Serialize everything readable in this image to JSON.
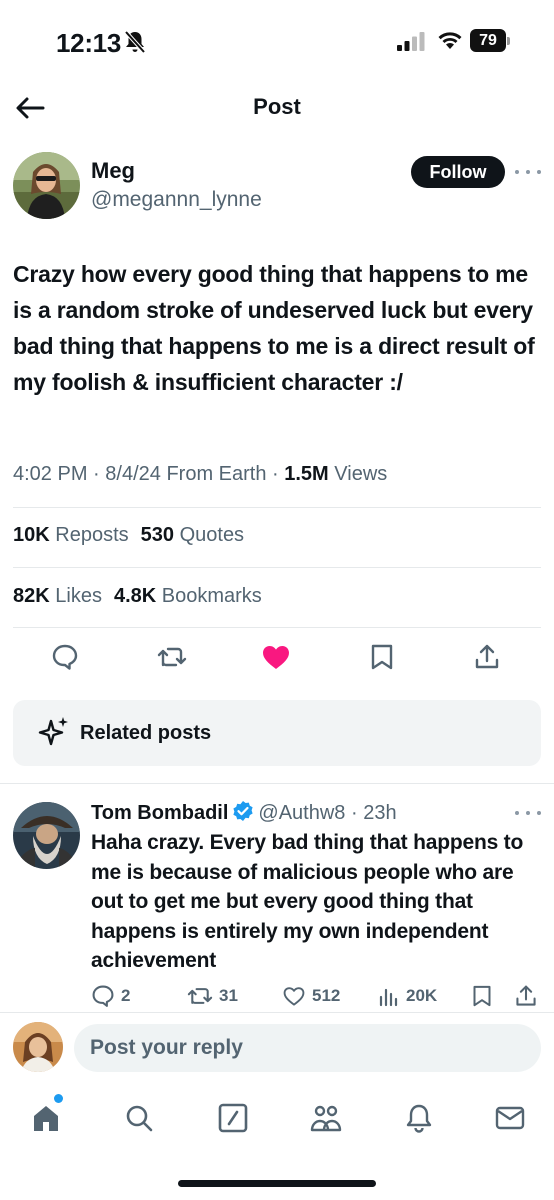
{
  "status_bar": {
    "time": "12:13",
    "battery": "79",
    "icons": [
      "bell-slash-icon",
      "signal-icon",
      "wifi-icon",
      "battery-icon"
    ]
  },
  "header": {
    "title": "Post",
    "back_icon": "arrow-left-icon"
  },
  "post": {
    "author": {
      "name": "Meg",
      "handle": "@megannn_lynne"
    },
    "follow_label": "Follow",
    "text": "Crazy how every good thing that happens to me is a random stroke of undeserved luck but every bad thing that happens to me is a direct result of my foolish & insufficient character :/",
    "meta": {
      "time": "4:02 PM",
      "date": "8/4/24",
      "location": "From Earth",
      "views_count": "1.5M",
      "views_label": "Views"
    },
    "stats": {
      "reposts_count": "10K",
      "reposts_label": "Reposts",
      "quotes_count": "530",
      "quotes_label": "Quotes",
      "likes_count": "82K",
      "likes_label": "Likes",
      "bookmarks_count": "4.8K",
      "bookmarks_label": "Bookmarks"
    },
    "actions": [
      "reply-icon",
      "repost-icon",
      "like-icon",
      "bookmark-icon",
      "share-icon"
    ],
    "liked": true
  },
  "related_posts": {
    "label": "Related posts",
    "icon": "sparkle-icon"
  },
  "reply": {
    "name": "Tom Bombadil",
    "verified": true,
    "handle": "@Authw8",
    "time": "23h",
    "text": "Haha crazy. Every bad thing that happens to me is because of malicious people who are out to get me but every good thing that happens is entirely my own independent achievement",
    "replies": "2",
    "reposts": "31",
    "likes": "512",
    "views": "20K"
  },
  "composer": {
    "placeholder": "Post your reply"
  },
  "tabbar": {
    "tabs": [
      "home-icon",
      "search-icon",
      "grok-icon",
      "communities-icon",
      "notifications-icon",
      "messages-icon"
    ],
    "home_has_dot": true
  },
  "colors": {
    "text": "#0f1419",
    "secondary": "#536471",
    "like": "#f91880",
    "verified": "#1d9bf0",
    "follow_bg": "#0f1419"
  }
}
